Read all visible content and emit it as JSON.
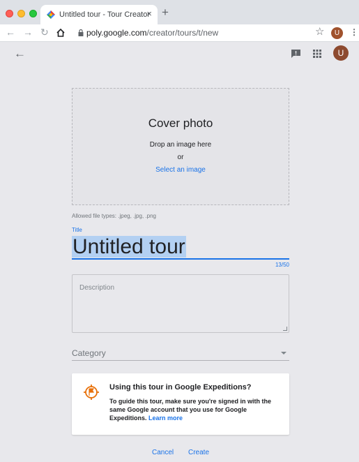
{
  "browser": {
    "tab_title": "Untitled tour - Tour Creator",
    "tab_close": "×",
    "new_tab": "+",
    "url_host": "poly.google.com",
    "url_path": "/creator/tours/t/new",
    "profile_initial": "U",
    "star_icon": "star-icon"
  },
  "header": {
    "back": "←",
    "avatar_initial": "U"
  },
  "cover": {
    "title": "Cover photo",
    "drop_text": "Drop an image here",
    "or_text": "or",
    "select_link": "Select an image"
  },
  "form": {
    "allowed_types": "Allowed file types: .jpeg, .jpg, .png",
    "title_label": "Title",
    "title_value": "Untitled tour",
    "title_counter": "13/50",
    "description_placeholder": "Description",
    "category_label": "Category"
  },
  "info": {
    "heading": "Using this tour in Google Expeditions?",
    "body": "To guide this tour, make sure you're signed in with the same Google account that you use for Google Expeditions.",
    "learn_more": "Learn more"
  },
  "actions": {
    "cancel": "Cancel",
    "create": "Create"
  },
  "colors": {
    "accent": "#1a73e8",
    "avatar": "#8d4a2f",
    "flag": "#e8710a"
  }
}
